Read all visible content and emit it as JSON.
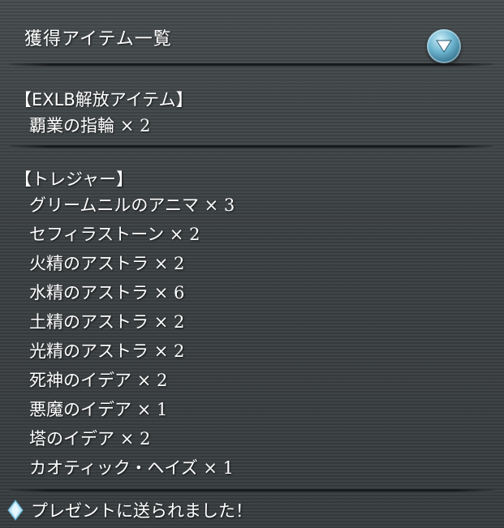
{
  "header": {
    "title": "獲得アイテム一覧"
  },
  "sections": [
    {
      "heading": "【EXLB解放アイテム】",
      "items": [
        {
          "name": "覇業の指輪",
          "mult": "× 2"
        }
      ]
    },
    {
      "heading": "【トレジャー】",
      "items": [
        {
          "name": "グリームニルのアニマ",
          "mult": "× 3"
        },
        {
          "name": "セフィラストーン",
          "mult": "× 2"
        },
        {
          "name": "火精のアストラ",
          "mult": "× 2"
        },
        {
          "name": "水精のアストラ",
          "mult": "× 6"
        },
        {
          "name": "土精のアストラ",
          "mult": "× 2"
        },
        {
          "name": "光精のアストラ",
          "mult": "× 2"
        },
        {
          "name": "死神のイデア",
          "mult": "× 2"
        },
        {
          "name": "悪魔のイデア",
          "mult": "× 1"
        },
        {
          "name": "塔のイデア",
          "mult": "× 2"
        },
        {
          "name": "カオティック・ヘイズ",
          "mult": "× 1"
        }
      ]
    }
  ],
  "footer": {
    "icon": "gem-icon",
    "message": "プレゼントに送られました！"
  },
  "colors": {
    "text": "#ffffff",
    "background": "#3b4042",
    "accent": "#6fb6d0"
  }
}
